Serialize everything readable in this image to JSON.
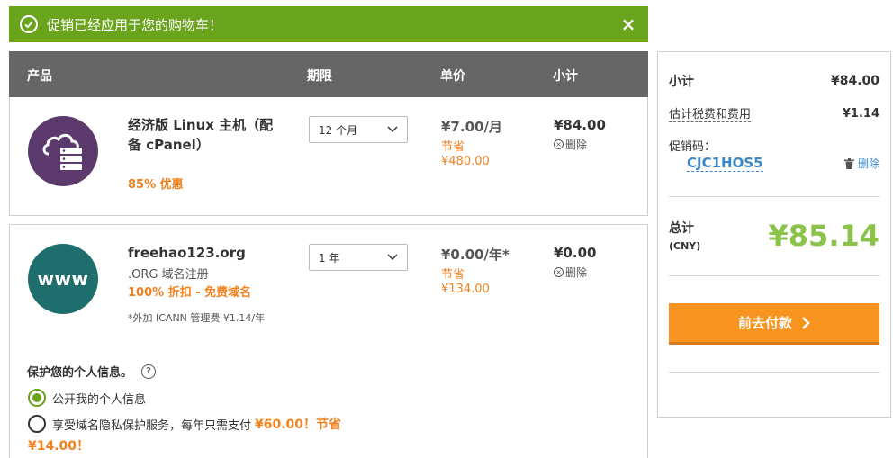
{
  "alert": {
    "message": "促销已经应用于您的购物车！",
    "close": "×"
  },
  "table_header": {
    "product": "产品",
    "term": "期限",
    "unit_price": "单价",
    "subtotal": "小计"
  },
  "items": [
    {
      "icon": "cloud-server-icon",
      "name_line1": "经济版 Linux 主机（配",
      "name_line2": "备 cPanel）",
      "promo": "85% 优惠",
      "term": "12 个月",
      "price": "¥7.00/月",
      "save_label": "节省",
      "save_amount": "¥480.00",
      "subtotal": "¥84.00",
      "remove": "删除"
    },
    {
      "icon": "www-icon",
      "icon_text": "www",
      "name": "freehao123.org",
      "desc": ".ORG 域名注册",
      "promo": "100% 折扣 - 免费域名",
      "fee_note": "*外加 ICANN 管理费 ¥1.14/年",
      "term": "1 年",
      "price": "¥0.00/年*",
      "save_label": "节省",
      "save_amount": "¥134.00",
      "subtotal": "¥0.00",
      "remove": "删除"
    }
  ],
  "privacy": {
    "title": "保护您的个人信息。",
    "help": "?",
    "option_public": "公开我的个人信息",
    "option_protect_text": "享受域名隐私保护服务，每年只需支付",
    "option_protect_price": "¥60.00！节省",
    "option_protect_save": "¥14.00！"
  },
  "summary": {
    "subtotal_label": "小计",
    "subtotal_value": "¥84.00",
    "tax_label": "估计税费和费用",
    "tax_value": "¥1.14",
    "promo_label": "促销码：",
    "promo_code": "CJC1HOS5",
    "promo_remove": "删除",
    "total_label": "总计",
    "currency": "(CNY)",
    "total_value": "¥85.14",
    "checkout": "前去付款"
  },
  "colors": {
    "success": "#6aa41c",
    "accent": "#f7931e",
    "orange_text": "#f1801f",
    "link": "#3a87c7",
    "total": "#8bc34a"
  }
}
